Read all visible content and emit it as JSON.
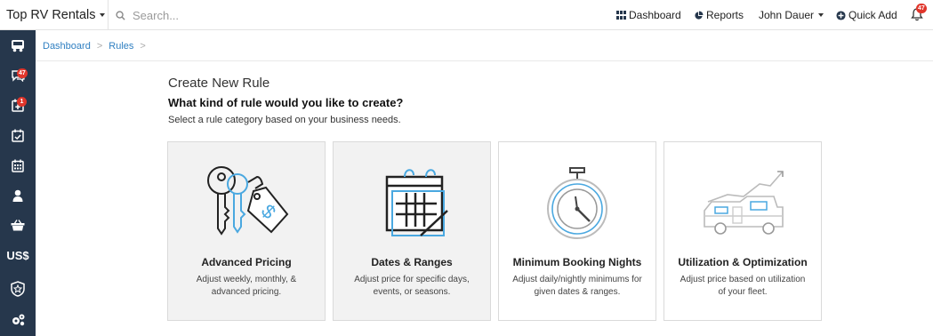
{
  "header": {
    "brand": "Top RV Rentals",
    "search_placeholder": "Search...",
    "nav": {
      "dashboard": "Dashboard",
      "reports": "Reports",
      "user": "John Dauer",
      "quick_add": "Quick Add"
    },
    "notifications_count": "47"
  },
  "sidebar": {
    "messages_badge": "47",
    "tasks_badge": "1",
    "currency_label": "US$"
  },
  "breadcrumb": {
    "items": [
      "Dashboard",
      "Rules"
    ],
    "separator": ">"
  },
  "main": {
    "title": "Create New Rule",
    "question": "What kind of rule would you like to create?",
    "subtitle": "Select a rule category based on your business needs.",
    "cards": [
      {
        "title": "Advanced Pricing",
        "desc": "Adjust weekly, monthly, & advanced pricing.",
        "icon": "keys-price-tag-icon"
      },
      {
        "title": "Dates & Ranges",
        "desc": "Adjust price for specific days, events, or seasons.",
        "icon": "calendar-icon"
      },
      {
        "title": "Minimum Booking Nights",
        "desc": "Adjust daily/nightly minimums for given dates & ranges.",
        "icon": "stopwatch-icon"
      },
      {
        "title": "Utilization & Optimization",
        "desc": "Adjust price based on utilization of your fleet.",
        "icon": "rv-growth-icon"
      }
    ]
  },
  "colors": {
    "sidebar_bg": "#26374c",
    "link": "#2f7fc1",
    "accent_blue": "#4aa8e0",
    "badge_red": "#e0352b",
    "card_selected_bg": "#f2f2f2"
  }
}
